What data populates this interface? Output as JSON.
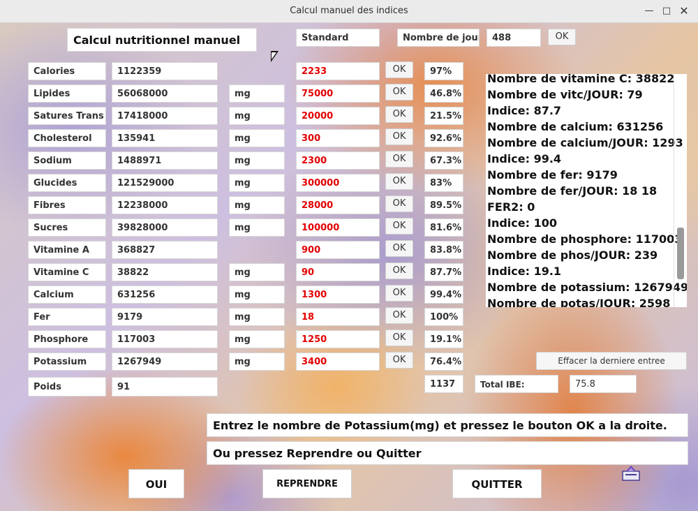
{
  "window": {
    "title": "Calcul manuel des indices"
  },
  "header": {
    "app_heading": "Calcul nutritionnel manuel",
    "standard_label": "Standard",
    "days_label": "Nombre de jours",
    "days_value": "488",
    "days_ok": "OK"
  },
  "rows": [
    {
      "name": "Calories",
      "value": "1122359",
      "unit": "",
      "standard": "2233",
      "ok": "OK",
      "pct": "97%"
    },
    {
      "name": "Lipides",
      "value": "56068000",
      "unit": "mg",
      "standard": "75000",
      "ok": "OK",
      "pct": "46.8%"
    },
    {
      "name": "Satures Trans",
      "value": "17418000",
      "unit": "mg",
      "standard": "20000",
      "ok": "OK",
      "pct": "21.5%"
    },
    {
      "name": "Cholesterol",
      "value": "135941",
      "unit": "mg",
      "standard": "300",
      "ok": "OK",
      "pct": "92.6%"
    },
    {
      "name": "Sodium",
      "value": "1488971",
      "unit": "mg",
      "standard": "2300",
      "ok": "OK",
      "pct": "67.3%"
    },
    {
      "name": "Glucides",
      "value": "121529000",
      "unit": "mg",
      "standard": "300000",
      "ok": "OK",
      "pct": "83%"
    },
    {
      "name": "Fibres",
      "value": "12238000",
      "unit": "mg",
      "standard": "28000",
      "ok": "OK",
      "pct": "89.5%"
    },
    {
      "name": "Sucres",
      "value": "39828000",
      "unit": "mg",
      "standard": "100000",
      "ok": "OK",
      "pct": "81.6%"
    },
    {
      "name": "Vitamine A",
      "value": "368827",
      "unit": "",
      "standard": "900",
      "ok": "OK",
      "pct": "83.8%"
    },
    {
      "name": "Vitamine C",
      "value": "38822",
      "unit": "mg",
      "standard": "90",
      "ok": "OK",
      "pct": "87.7%"
    },
    {
      "name": "Calcium",
      "value": "631256",
      "unit": "mg",
      "standard": "1300",
      "ok": "OK",
      "pct": "99.4%"
    },
    {
      "name": "Fer",
      "value": "9179",
      "unit": "mg",
      "standard": "18",
      "ok": "OK",
      "pct": "100%"
    },
    {
      "name": "Phosphore",
      "value": "117003",
      "unit": "mg",
      "standard": "1250",
      "ok": "OK",
      "pct": "19.1%"
    },
    {
      "name": "Potassium",
      "value": "1267949",
      "unit": "mg",
      "standard": "3400",
      "ok": "OK",
      "pct": "76.4%"
    }
  ],
  "poids": {
    "label": "Poids",
    "value": "91",
    "count": "1137"
  },
  "total": {
    "label": "Total IBE:",
    "value": "75.8"
  },
  "log_lines": [
    "Nombre de vitamine C: 38822",
    "Nombre de vitc/JOUR: 79",
    "Indice: 87.7",
    "Nombre de calcium: 631256",
    "Nombre de calcium/JOUR: 1293",
    "Indice: 99.4",
    "Nombre de fer: 9179",
    "Nombre de fer/JOUR: 18 18",
    "FER2: 0",
    "Indice: 100",
    "Nombre de phosphore: 117003",
    "Nombre de phos/JOUR: 239",
    "Indice: 19.1",
    "Nombre de potassium: 1267949",
    "Nombre de potas/JOUR: 2598"
  ],
  "clear_button": "Effacer la derniere entree",
  "messages": {
    "line1": "Entrez le nombre de Potassium(mg) et pressez le bouton OK a la droite.",
    "line2": "Ou pressez Reprendre ou Quitter"
  },
  "buttons": {
    "oui": "OUI",
    "reprendre": "REPRENDRE",
    "quitter": "QUITTER"
  }
}
